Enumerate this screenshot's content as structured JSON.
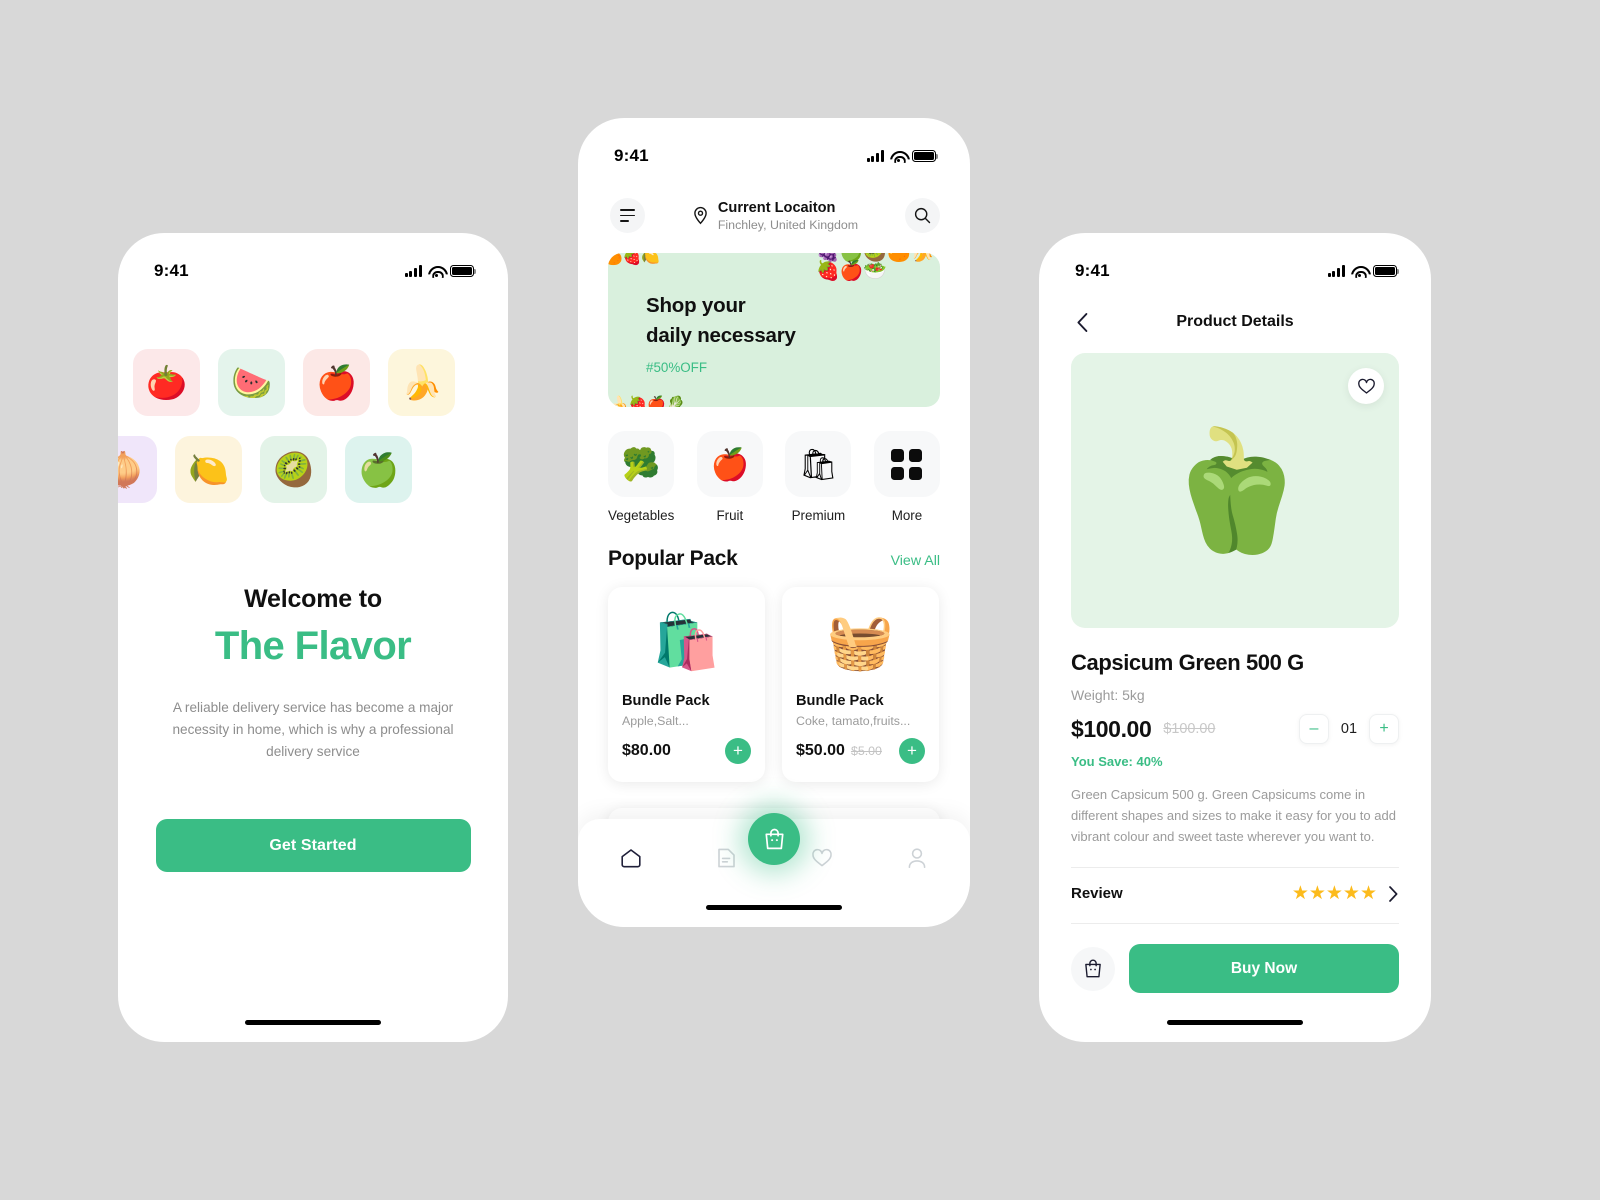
{
  "theme": {
    "accent": "#3abd85",
    "page_bg": "#d8d8d8",
    "banner_bg": "#d9f0dd",
    "product_img_bg": "#e4f4e7",
    "star_color": "#fcbb1c",
    "muted_text": "#9b9b9b"
  },
  "onboarding": {
    "status": {
      "time": "9:41"
    },
    "tiles_row1": [
      {
        "name": "tomato",
        "glyph": "🍅",
        "bg": "#fce8e9"
      },
      {
        "name": "watermelon",
        "glyph": "🍉",
        "bg": "#e4f4ec"
      },
      {
        "name": "apple",
        "glyph": "🍎",
        "bg": "#fce8e6"
      },
      {
        "name": "banana",
        "glyph": "🍌",
        "bg": "#fdf6dc"
      }
    ],
    "tiles_row2": [
      {
        "name": "onion",
        "glyph": "🧅",
        "bg": "#f0e6fa"
      },
      {
        "name": "lemon",
        "glyph": "🍋",
        "bg": "#fdf4dd"
      },
      {
        "name": "kiwi",
        "glyph": "🥝",
        "bg": "#e3f3e8"
      },
      {
        "name": "green-apple",
        "glyph": "🍏",
        "bg": "#ddf3ee"
      }
    ],
    "welcome_label": "Welcome to",
    "brand_name": "The Flavor",
    "description": "A reliable delivery service has become a major necessity in home, which is why a professional delivery service",
    "cta_label": "Get Started"
  },
  "home": {
    "status": {
      "time": "9:41"
    },
    "header": {
      "menu_icon": "hamburger-icon",
      "location_icon": "map-pin-icon",
      "location_title": "Current Locaiton",
      "location_sub": "Finchley, United Kingdom",
      "search_icon": "search-icon"
    },
    "banner": {
      "heading_line1": "Shop your",
      "heading_line2": "daily necessary",
      "offer": "#50%OFF",
      "art_glyphs": "🍇🍏🥝🍊🍌🍓🍎🥗",
      "corner_top_left": "🍊🍓🍋",
      "corner_bottom_left": "🍌🍓🍎🥬"
    },
    "categories": [
      {
        "label": "Vegetables",
        "icon": "broccoli-icon",
        "glyph": "🥦"
      },
      {
        "label": "Fruit",
        "icon": "apple-icon",
        "glyph": "🍎"
      },
      {
        "label": "Premium",
        "icon": "grocery-bag-icon",
        "glyph": "🛍"
      },
      {
        "label": "More",
        "icon": "grid-icon",
        "glyph": ""
      }
    ],
    "section": {
      "title": "Popular Pack",
      "view_all": "View All"
    },
    "products": [
      {
        "title": "Bundle Pack",
        "subtitle": "Apple,Salt...",
        "price": "$80.00",
        "old_price": "",
        "image_icon": "grocery-bag-image",
        "glyph": "🛍️",
        "add_label": "+"
      },
      {
        "title": "Bundle Pack",
        "subtitle": "Coke, tamato,fruits...",
        "price": "$50.00",
        "old_price": "$5.00",
        "image_icon": "grocery-basket-image",
        "glyph": "🧺",
        "add_label": "+"
      }
    ],
    "tabs": [
      {
        "name": "home",
        "icon": "home-icon",
        "active": true
      },
      {
        "name": "orders",
        "icon": "document-icon",
        "active": false
      },
      {
        "name": "cart",
        "icon": "shopping-bag-icon",
        "active": false
      },
      {
        "name": "wishlist",
        "icon": "heart-icon",
        "active": false
      },
      {
        "name": "profile",
        "icon": "user-icon",
        "active": false
      }
    ]
  },
  "product_details": {
    "status": {
      "time": "9:41"
    },
    "back_icon": "chevron-left-icon",
    "title": "Product Details",
    "favorite_icon": "heart-outline-icon",
    "image_icon": "green-capsicum-image",
    "image_glyph": "🫑",
    "name": "Capsicum Green 500 G",
    "weight": "Weight: 5kg",
    "price": "$100.00",
    "old_price": "$100.00",
    "quantity": "01",
    "decrement_label": "–",
    "increment_label": "+",
    "savings": "You Save: 40%",
    "description": "Green Capsicum 500 g. Green Capsicums come in different shapes and sizes to make it easy for you to add vibrant colour and sweet taste wherever you want to.",
    "review_label": "Review",
    "rating": 5,
    "stars": "★★★★★",
    "review_chevron_icon": "chevron-right-icon",
    "bag_icon": "shopping-bag-icon",
    "buy_label": "Buy Now"
  }
}
